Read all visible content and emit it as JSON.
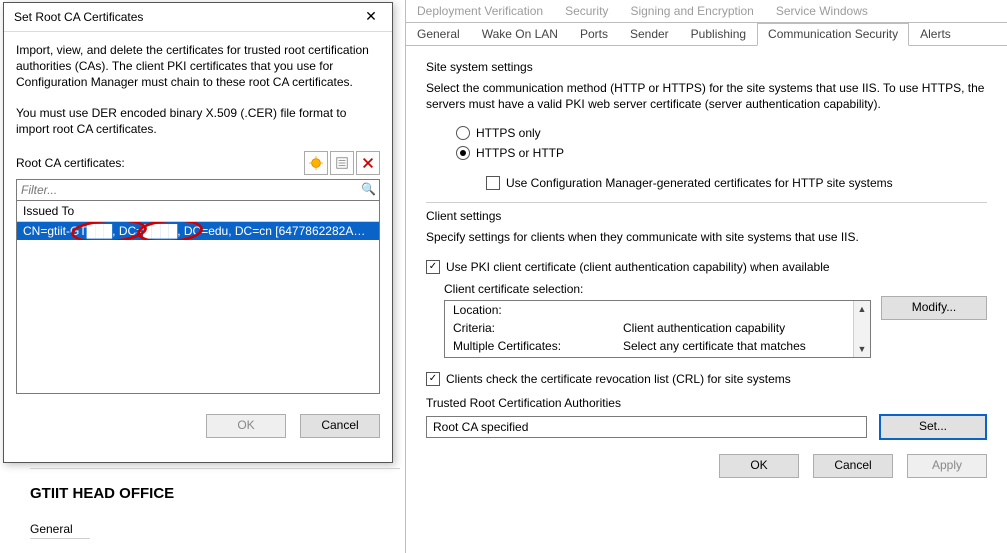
{
  "dialog": {
    "title": "Set Root CA Certificates",
    "intro": "Import, view, and delete the certificates for trusted root certification authorities (CAs). The client PKI certificates that you use for Configuration Manager must chain to these root CA certificates.",
    "note": "You must use DER encoded binary X.509 (.CER) file format to import root CA certificates.",
    "list_label": "Root CA certificates:",
    "filter_placeholder": "Filter...",
    "col_header": "Issued To",
    "row0": "CN=gtiit-GT███, DC=████, DC=edu, DC=cn [6477862282AA22E...",
    "ok": "OK",
    "cancel": "Cancel"
  },
  "tabs": {
    "r0": [
      "Deployment Verification",
      "Security",
      "Signing and Encryption",
      "Service Windows"
    ],
    "r1": [
      "General",
      "Wake On LAN",
      "Ports",
      "Sender",
      "Publishing",
      "Communication Security",
      "Alerts"
    ]
  },
  "right": {
    "sec1_title": "Site system settings",
    "sec1_help": "Select the communication method (HTTP or HTTPS) for the site systems that use IIS. To use HTTPS, the servers must have a valid PKI web server certificate (server authentication capability).",
    "opt_https": "HTTPS only",
    "opt_either": "HTTPS or HTTP",
    "cm_gen": "Use Configuration Manager-generated certificates for HTTP site systems",
    "sec2_title": "Client settings",
    "sec2_help": "Specify settings for clients when they communicate with site systems that use IIS.",
    "use_pki": "Use PKI client certificate (client authentication capability) when available",
    "ccs_label": "Client certificate selection:",
    "kv": {
      "loc_k": "Location:",
      "crit_k": "Criteria:",
      "crit_v": "Client authentication capability",
      "mult_k": "Multiple Certificates:",
      "mult_v": "Select any certificate that matches"
    },
    "modify": "Modify...",
    "crl": "Clients check the certificate revocation list (CRL) for site systems",
    "trca_label": "Trusted Root Certification Authorities",
    "trca_value": "Root CA specified",
    "set": "Set...",
    "ok": "OK",
    "cancel": "Cancel",
    "apply": "Apply"
  },
  "card": {
    "title": "GTIIT HEAD OFFICE",
    "general": "General"
  }
}
